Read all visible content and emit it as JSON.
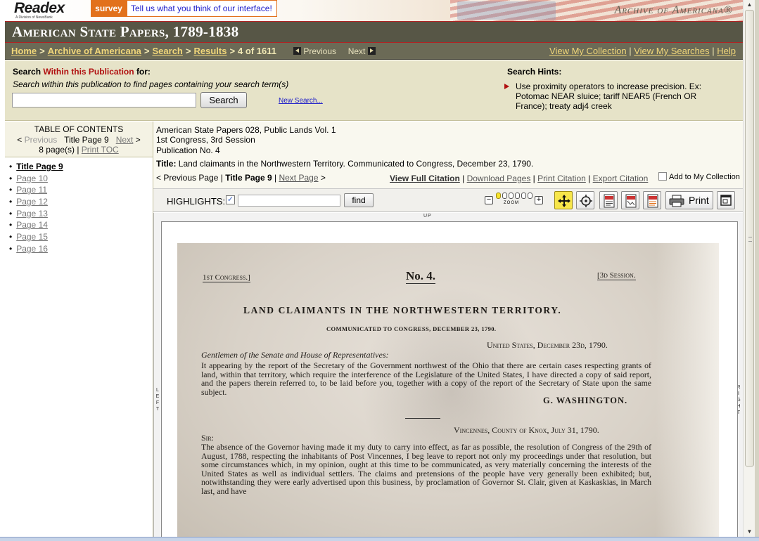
{
  "banner": {
    "brand": "Readex",
    "brand_sub": "A Division of NewsBank",
    "survey_label": "survey",
    "survey_message": "Tell us what you think of our interface!",
    "archive_logo": "Archive of Americana®"
  },
  "title": "American State Papers, 1789-1838",
  "nav": {
    "breadcrumbs": [
      "Home",
      "Archive of Americana",
      "Search",
      "Results"
    ],
    "position": "4 of 1611",
    "previous": "Previous",
    "next": "Next",
    "links": [
      "View My Collection",
      "View My Searches",
      "Help"
    ]
  },
  "search": {
    "heading_prefix": "Search",
    "heading_highlight": "Within this Publication",
    "heading_suffix": "for:",
    "description": "Search within this publication to find pages containing your search term(s)",
    "input_value": "",
    "button": "Search",
    "new_search": "New Search...",
    "hints_title": "Search Hints:",
    "hints_text": "Use proximity operators to increase precision. Ex: Potomac NEAR sluice; tariff NEAR5 (French OR France); treaty adj4 creek"
  },
  "toc": {
    "title": "TABLE OF CONTENTS",
    "previous": "Previous",
    "current": "Title Page 9",
    "next": "Next",
    "count": "8 page(s)",
    "print": "Print TOC",
    "items": [
      {
        "label": "Title Page 9",
        "current": true
      },
      {
        "label": "Page 10"
      },
      {
        "label": "Page 11"
      },
      {
        "label": "Page 12"
      },
      {
        "label": "Page 13"
      },
      {
        "label": "Page 14"
      },
      {
        "label": "Page 15"
      },
      {
        "label": "Page 16"
      }
    ]
  },
  "doc": {
    "line1": "American State Papers 028, Public Lands Vol. 1",
    "line2": "1st Congress, 3rd Session",
    "line3": "Publication No. 4",
    "title_label": "Title:",
    "title": "Land claimants in the Northwestern Territory. Communicated to Congress, December 23, 1790.",
    "prev_page": "Previous Page",
    "current_page": "Title Page 9",
    "next_page": "Next Page",
    "actions": [
      "View Full Citation",
      "Download Pages",
      "Print Citation",
      "Export Citation"
    ],
    "add_collection": "Add to My Collection"
  },
  "toolbar": {
    "highlights_label": "HIGHLIGHTS:",
    "highlights_checked": true,
    "highlight_input": "",
    "find": "find",
    "zoom_label": "ZOOM",
    "zoom_level": 1,
    "zoom_levels": 6,
    "print": "Print"
  },
  "viewer": {
    "pan_up": "UP",
    "pan_left": "LEFT",
    "pan_right": "RIGHT"
  },
  "scan": {
    "header_left": "1st Congress.]",
    "header_center": "No. 4.",
    "header_right": "[3d Session.",
    "title": "LAND CLAIMANTS IN THE NORTHWESTERN TERRITORY.",
    "subtitle": "COMMUNICATED TO CONGRESS, DECEMBER 23, 1790.",
    "dateline": "United States, December 23d, 1790.",
    "salutation": "Gentlemen of the Senate and House of Representatives:",
    "paragraph1": "It appearing by the report of the Secretary of the Government northwest of the Ohio that there are certain cases respecting grants of land, within that territory, which require the interference of the Legislature of the United States, I have directed a copy of said report, and the papers therein referred to, to be laid before you, together with a copy of the report of the Secretary of State upon the same subject.",
    "signature": "G. WASHINGTON.",
    "place": "Vincennes, County of Knox, July 31, 1790.",
    "sir": "Sir:",
    "paragraph2": "The absence of the Governor having made it my duty to carry into effect, as far as possible, the resolution of Congress of the 29th of August, 1788, respecting the inhabitants of Post Vincennes, I beg leave to report not only my proceedings under that resolution, but some circumstances which, in my opinion, ought at this time to be communicated, as very materially concerning the interests of the United States as well as individual settlers. The claims and pretensions of the people have very generally been exhibited; but, notwithstanding they were early advertised upon this business, by proclamation of Governor St. Clair, given at Kaskaskias, in March last, and have"
  }
}
